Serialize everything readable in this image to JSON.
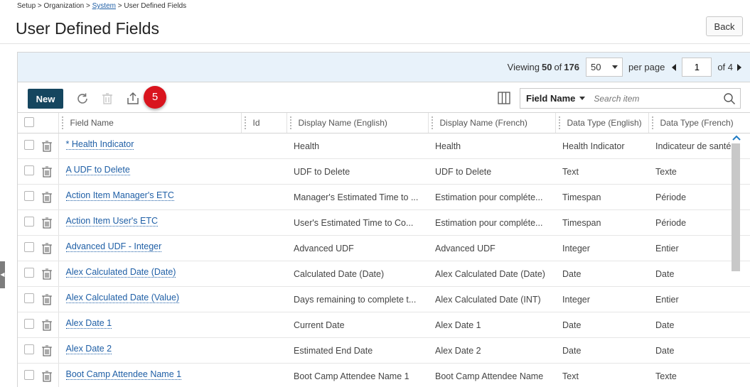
{
  "breadcrumb": {
    "part1": "Setup > Organization > ",
    "system": "System",
    "part2": " > User Defined Fields"
  },
  "page": {
    "title": "User Defined Fields",
    "back_label": "Back"
  },
  "pager": {
    "viewing": "Viewing",
    "count": "50",
    "of": "of",
    "total": "176",
    "per_page_value": "50",
    "per_page_label": "per page",
    "current_page": "1",
    "of_pages": "of 4"
  },
  "toolbar": {
    "new_label": "New",
    "badge_count": "5",
    "search_field": "Field Name",
    "search_placeholder": "Search item"
  },
  "columns": [
    "Field Name",
    "Id",
    "Display Name (English)",
    "Display Name (French)",
    "Data Type (English)",
    "Data Type (French)"
  ],
  "rows": [
    {
      "field_name": "* Health Indicator",
      "id": "",
      "display_en": "Health",
      "display_fr": "Health",
      "type_en": "Health Indicator",
      "type_fr": "Indicateur de santé"
    },
    {
      "field_name": "A UDF to Delete",
      "id": "",
      "display_en": "UDF to Delete",
      "display_fr": "UDF to Delete",
      "type_en": "Text",
      "type_fr": "Texte"
    },
    {
      "field_name": "Action Item Manager's ETC",
      "id": "",
      "display_en": "Manager's Estimated Time to ...",
      "display_fr": "Estimation pour compléte...",
      "type_en": "Timespan",
      "type_fr": "Période"
    },
    {
      "field_name": "Action Item User's ETC",
      "id": "",
      "display_en": "User's Estimated Time to Co...",
      "display_fr": "Estimation pour compléte...",
      "type_en": "Timespan",
      "type_fr": "Période"
    },
    {
      "field_name": "Advanced UDF - Integer",
      "id": "",
      "display_en": "Advanced UDF",
      "display_fr": "Advanced UDF",
      "type_en": "Integer",
      "type_fr": "Entier"
    },
    {
      "field_name": "Alex Calculated Date (Date)",
      "id": "",
      "display_en": "Calculated Date (Date)",
      "display_fr": "Alex Calculated Date (Date)",
      "type_en": "Date",
      "type_fr": "Date"
    },
    {
      "field_name": "Alex Calculated Date (Value)",
      "id": "",
      "display_en": "Days remaining to complete t...",
      "display_fr": "Alex Calculated Date (INT)",
      "type_en": "Integer",
      "type_fr": "Entier"
    },
    {
      "field_name": "Alex Date 1",
      "id": "",
      "display_en": "Current Date",
      "display_fr": "Alex Date 1",
      "type_en": "Date",
      "type_fr": "Date"
    },
    {
      "field_name": "Alex Date 2",
      "id": "",
      "display_en": "Estimated End Date",
      "display_fr": "Alex Date 2",
      "type_en": "Date",
      "type_fr": "Date"
    },
    {
      "field_name": "Boot Camp Attendee Name 1",
      "id": "",
      "display_en": "Boot Camp Attendee Name 1",
      "display_fr": "Boot Camp Attendee Name",
      "type_en": "Text",
      "type_fr": "Texte"
    }
  ],
  "icons": {
    "refresh": "refresh-icon",
    "delete": "trash-icon",
    "export": "export-icon",
    "columns": "columns-icon",
    "search": "search-icon"
  },
  "colors": {
    "accent": "#15465f",
    "badge": "#d9141e",
    "link": "#1f5fa6",
    "pager_bg": "#e8f2fa"
  }
}
